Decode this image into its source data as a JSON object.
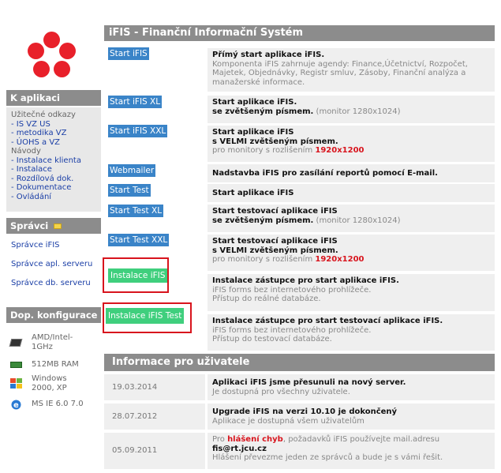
{
  "sidebar": {
    "app_header": "K aplikaci",
    "nav": [
      {
        "label": "Užitečné odkazy",
        "link": false
      },
      {
        "label": "- IS VZ US",
        "link": true
      },
      {
        "label": "- metodika VZ",
        "link": true
      },
      {
        "label": "- ÚOHS a VZ",
        "link": true
      },
      {
        "label": "Návody",
        "link": false
      },
      {
        "label": "- Instalace klienta",
        "link": true
      },
      {
        "label": "- Instalace",
        "link": true
      },
      {
        "label": "- Rozdílová dok.",
        "link": true
      },
      {
        "label": "- Dokumentace",
        "link": true
      },
      {
        "label": "- Ovládání",
        "link": true
      }
    ],
    "admins_header": "Správci",
    "admins": [
      "Správce iFIS",
      "Správce apl. serveru",
      "Správce db. serveru"
    ],
    "config_header": "Dop. konfigurace",
    "config": [
      {
        "icon": "cpu-icon",
        "text": "AMD/Intel- 1GHz"
      },
      {
        "icon": "memory-icon",
        "text": "512MB RAM"
      },
      {
        "icon": "windows-icon",
        "text": "Windows 2000, XP"
      },
      {
        "icon": "ie-icon",
        "text": "MS IE 6.0 7.0"
      }
    ]
  },
  "main": {
    "title": "iFIS - Finanční Informační Systém",
    "buttons": {
      "b1": "Start iFIS",
      "b2": "Start iFIS XL",
      "b3": "Start iFIS XXL",
      "b4": "Webmailer",
      "b5": "Start Test",
      "b6": "Start Test XL",
      "b7": "Start Test XXL",
      "b8": "Instalace iFIS",
      "b9": "Instalace iFIS Test"
    },
    "desc": {
      "d1_title": "Přímý start aplikace iFIS.",
      "d1_text": "Komponenta iFIS zahrnuje agendy: Finance,Účetnictví, Rozpočet, Majetek, Objednávky, Registr smluv, Zásoby, Finanční analýza a manažerské informace.",
      "d2_title": "Start aplikace iFIS.",
      "d2_sub": "se zvětšeným písmem.",
      "d2_mon": "(monitor 1280x1024)",
      "d3_title": "Start aplikace iFIS",
      "d3_sub": "s VELMI zvětšeným písmem.",
      "d3_mon": "pro monitory s rozlišením",
      "d3_res": "1920x1200",
      "d4_title": "Nadstavba iFIS pro zasílání reportů pomocí E-mail.",
      "d5_title": "Start aplikace iFIS",
      "d6_title": "Start testovací aplikace iFIS",
      "d6_sub": "se zvětšeným písmem.",
      "d6_mon": "(monitor 1280x1024)",
      "d7_title": "Start testovací aplikace iFIS",
      "d7_sub": "s VELMI zvětšeným písmem.",
      "d7_mon": "pro monitory s rozlišením",
      "d7_res": "1920x1200",
      "d8_title": "Instalace zástupce pro start aplikace iFIS.",
      "d8_l2": "iFIS forms bez internetového prohlížeče.",
      "d8_l3": "Přístup do reálné databáze.",
      "d9_title": "Instalace zástupce pro start testovací aplikace iFIS.",
      "d9_l2": "iFIS forms bez internetového prohlížeče.",
      "d9_l3": "Přístup do testovací databáze."
    }
  },
  "info": {
    "header": "Informace pro uživatele",
    "rows": [
      {
        "date": "19.03.2014",
        "title": "Aplikaci iFIS jsme přesunuli na nový server.",
        "text": "Je dostupná pro všechny uživatele."
      },
      {
        "date": "28.07.2012",
        "title": "Upgrade iFIS na verzi 10.10 je dokončený",
        "text": "Aplikace je dostupná všem uživatelům"
      },
      {
        "date": "05.09.2011",
        "pre": "Pro",
        "red": "hlášení chyb",
        "mid": ", požadavků iFIS používejte mail.adresu",
        "mail": "fis@rt.jcu.cz",
        "text": "Hlášení převezme jeden ze správců a bude je s vámi řešit."
      }
    ]
  },
  "colors": {
    "header_gray": "#8c8c8c",
    "button_blue": "#3a84c8",
    "button_green": "#3fcf7d",
    "highlight_red": "#d8141d",
    "logo_red": "#e8202a"
  }
}
